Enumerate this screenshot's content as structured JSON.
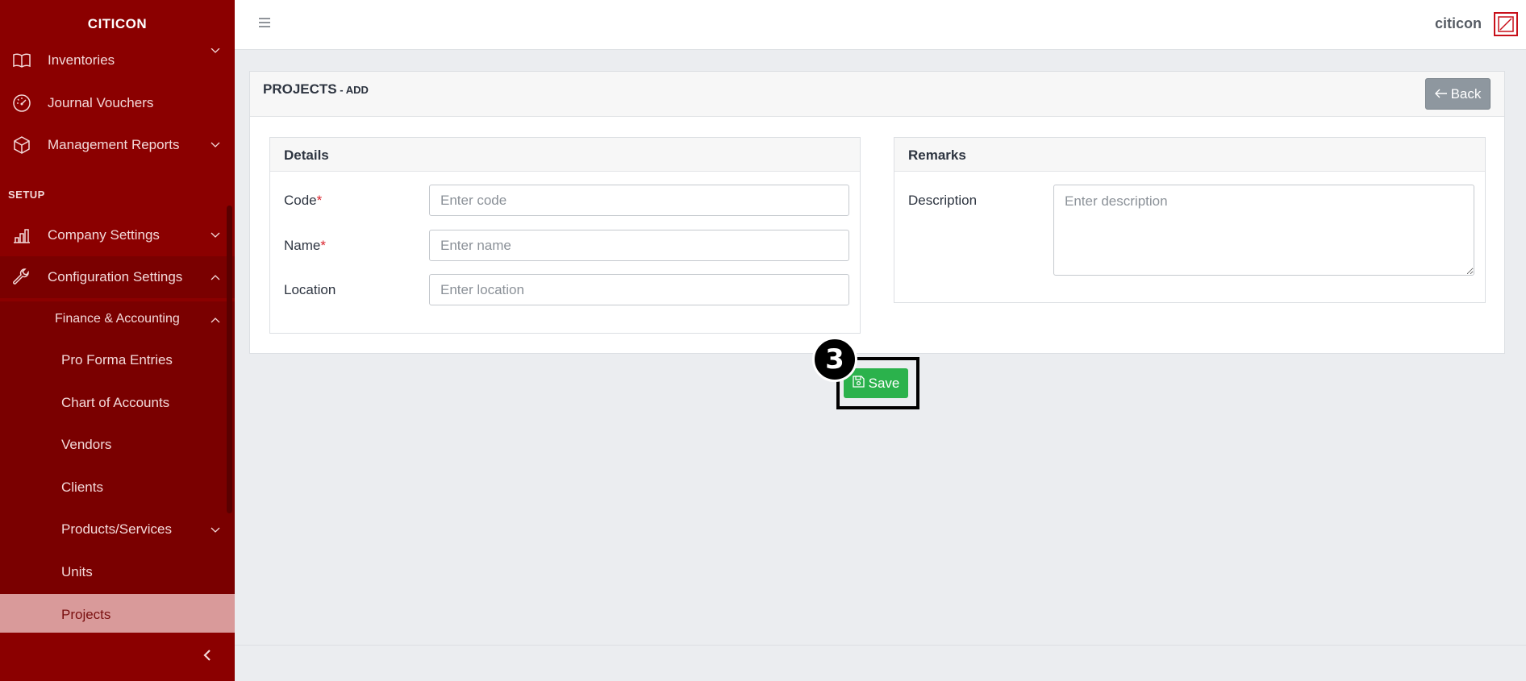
{
  "app": {
    "brand": "CITICON",
    "user": "citicon"
  },
  "sidebar": {
    "items": [
      {
        "label": "Inventories",
        "icon": "book-icon"
      },
      {
        "label": "Journal Vouchers",
        "icon": "gauge-icon"
      },
      {
        "label": "Management Reports",
        "icon": "box-icon"
      }
    ],
    "section": "SETUP",
    "setup_items": [
      {
        "label": "Company Settings",
        "icon": "chart-icon"
      },
      {
        "label": "Configuration Settings",
        "icon": "wrench-icon"
      }
    ],
    "sub_group": "Finance & Accounting",
    "sub_items": [
      {
        "label": "Pro Forma Entries"
      },
      {
        "label": "Chart of Accounts"
      },
      {
        "label": "Vendors"
      },
      {
        "label": "Clients"
      },
      {
        "label": "Products/Services"
      },
      {
        "label": "Units"
      },
      {
        "label": "Projects",
        "active": true
      }
    ]
  },
  "page": {
    "title": "PROJECTS",
    "title_sub": " - ADD",
    "back_label": "Back"
  },
  "details": {
    "title": "Details",
    "fields": [
      {
        "label": "Code",
        "required": "*",
        "placeholder": "Enter code"
      },
      {
        "label": "Name",
        "required": "*",
        "placeholder": "Enter name"
      },
      {
        "label": "Location",
        "required": "",
        "placeholder": "Enter location"
      }
    ]
  },
  "remarks": {
    "title": "Remarks",
    "description_label": "Description",
    "description_placeholder": "Enter description"
  },
  "actions": {
    "save_label": "Save",
    "step_number": "3"
  },
  "colors": {
    "sidebar": "#8b0000",
    "active_item": "#d99a9a",
    "save": "#2bb24c",
    "back": "#8e979f"
  }
}
